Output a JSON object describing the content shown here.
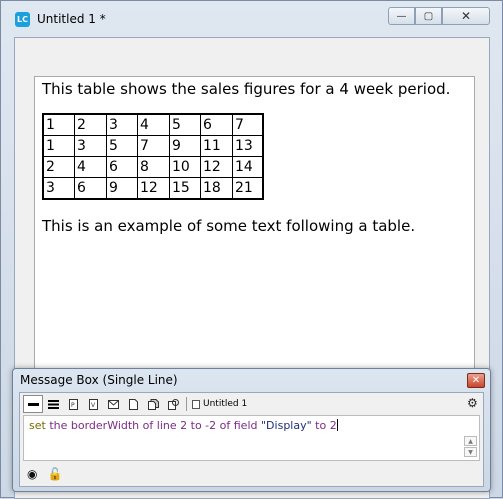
{
  "window": {
    "title": "Untitled 1 *",
    "app_icon_text": "LC",
    "controls": {
      "minimize": "—",
      "maximize": "▢",
      "close": "✕"
    }
  },
  "field": {
    "intro": "This table shows the sales figures for a 4 week period.",
    "table": [
      [
        "1",
        "2",
        "3",
        "4",
        "5",
        "6",
        "7"
      ],
      [
        "1",
        "3",
        "5",
        "7",
        "9",
        "11",
        "13"
      ],
      [
        "2",
        "4",
        "6",
        "8",
        "10",
        "12",
        "14"
      ],
      [
        "3",
        "6",
        "9",
        "12",
        "15",
        "18",
        "21"
      ]
    ],
    "outro": "This is an example of some text following a table."
  },
  "message_box": {
    "title": "Message Box (Single Line)",
    "close": "✕",
    "toolbar": {
      "icons": [
        "single-line-icon",
        "multi-line-icon",
        "global-properties-icon",
        "global-variables-icon",
        "pending-messages-icon",
        "front-scripts-icon",
        "back-scripts-icon",
        "message-watcher-icon"
      ],
      "stack_tab": "Untitled 1"
    },
    "command": [
      {
        "t": "set",
        "c": "kw"
      },
      {
        "t": " "
      },
      {
        "t": "the",
        "c": "op"
      },
      {
        "t": " "
      },
      {
        "t": "borderWidth",
        "c": "op"
      },
      {
        "t": " "
      },
      {
        "t": "of",
        "c": "op"
      },
      {
        "t": " "
      },
      {
        "t": "line",
        "c": "op"
      },
      {
        "t": " "
      },
      {
        "t": "2",
        "c": "num"
      },
      {
        "t": " "
      },
      {
        "t": "to",
        "c": "op"
      },
      {
        "t": " "
      },
      {
        "t": "-2",
        "c": "num"
      },
      {
        "t": " "
      },
      {
        "t": "of",
        "c": "op"
      },
      {
        "t": " "
      },
      {
        "t": "field",
        "c": "op"
      },
      {
        "t": " "
      },
      {
        "t": "\"Display\"",
        "c": "str"
      },
      {
        "t": " "
      },
      {
        "t": "to",
        "c": "op"
      },
      {
        "t": " "
      },
      {
        "t": "2",
        "c": "num"
      }
    ]
  }
}
